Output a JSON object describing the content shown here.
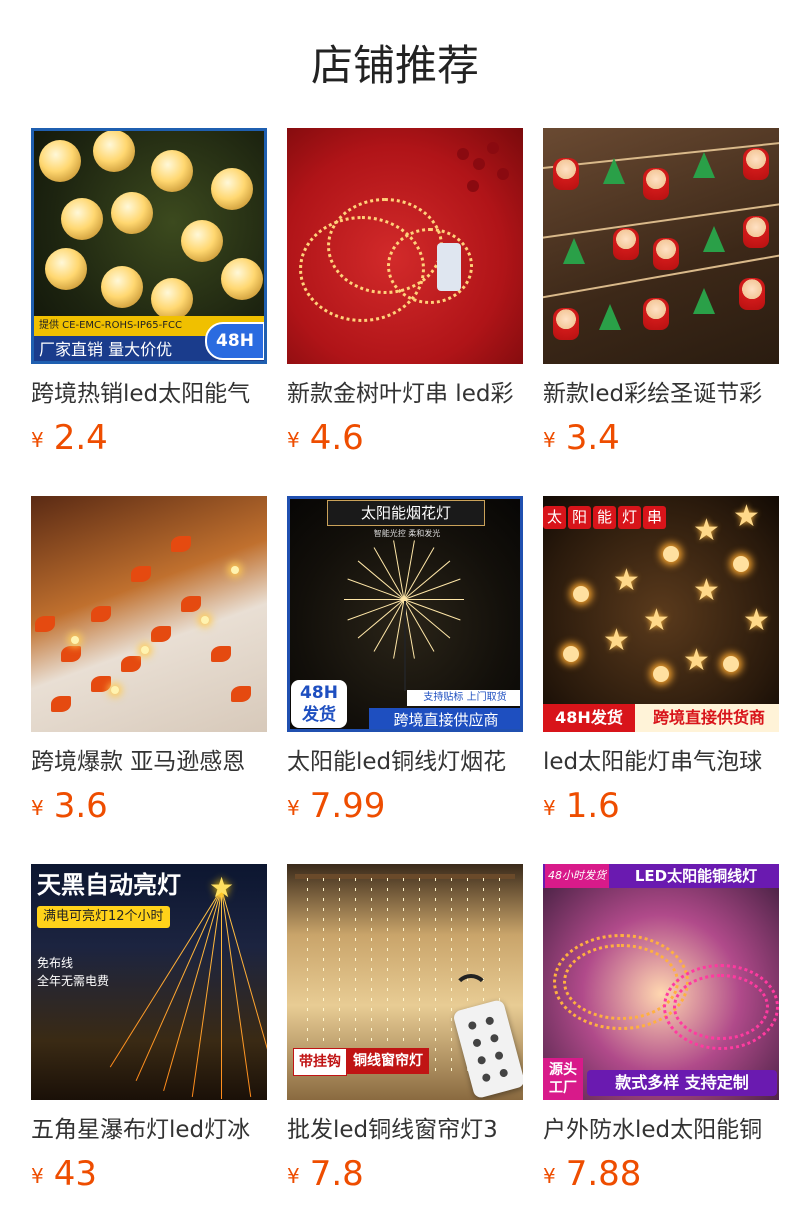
{
  "section": {
    "title": "店铺推荐"
  },
  "currency_symbol": "¥",
  "accent_color": "#ee4d00",
  "products": [
    {
      "name": "跨境热销led太阳能气",
      "price": "2.4",
      "image_text": {
        "cert": "提供 CE-EMC-ROHS-IP65-FCC",
        "band": "厂家直销 量大价优",
        "badge": "48H"
      }
    },
    {
      "name": "新款金树叶灯串 led彩",
      "price": "4.6"
    },
    {
      "name": "新款led彩绘圣诞节彩",
      "price": "3.4"
    },
    {
      "name": "跨境爆款 亚马逊感恩",
      "price": "3.6"
    },
    {
      "name": "太阳能led铜线灯烟花",
      "price": "7.99",
      "image_text": {
        "title": "太阳能烟花灯",
        "subtitle": "智能光控   柔和发光",
        "badge_line1": "48H",
        "badge_line2": "发货",
        "small": "支持贴标 上门取货",
        "band": "跨境直接供应商"
      }
    },
    {
      "name": "led太阳能灯串气泡球",
      "price": "1.6",
      "image_text": {
        "label_chars": [
          "太",
          "阳",
          "能",
          "灯",
          "串"
        ],
        "band_left": "48H发货",
        "band_right": "跨境直接供货商"
      }
    },
    {
      "name": "五角星瀑布灯led灯冰",
      "price": "43",
      "image_text": {
        "title": "天黑自动亮灯",
        "tag": "满电可亮灯12个小时",
        "line1": "免布线",
        "line2": "全年无需电费"
      }
    },
    {
      "name": "批发led铜线窗帘灯3",
      "price": "7.8",
      "image_text": {
        "tag_left": "带挂钩",
        "tag_right": "铜线窗帘灯"
      }
    },
    {
      "name": "户外防水led太阳能铜",
      "price": "7.88",
      "image_text": {
        "top_left": "48小时发货",
        "top_right": "LED太阳能铜线灯",
        "corner": "源头工厂",
        "band": "款式多样 支持定制"
      }
    }
  ]
}
